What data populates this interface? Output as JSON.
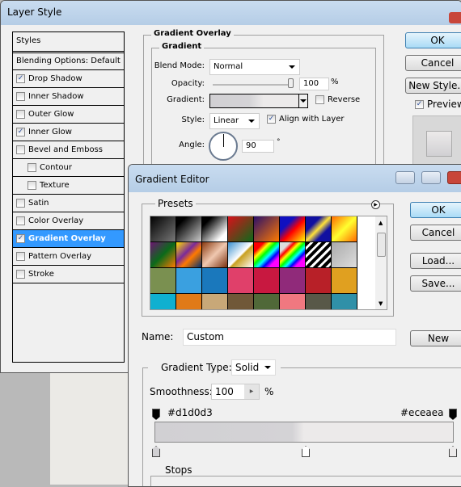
{
  "layer_style": {
    "title": "Layer Style",
    "styles_header": "Styles",
    "blending": "Blending Options: Default",
    "items": [
      {
        "label": "Drop Shadow",
        "checked": true
      },
      {
        "label": "Inner Shadow",
        "checked": false
      },
      {
        "label": "Outer Glow",
        "checked": false
      },
      {
        "label": "Inner Glow",
        "checked": true
      },
      {
        "label": "Bevel and Emboss",
        "checked": false
      },
      {
        "label": "Contour",
        "checked": false,
        "sub": true
      },
      {
        "label": "Texture",
        "checked": false,
        "sub": true
      },
      {
        "label": "Satin",
        "checked": false
      },
      {
        "label": "Color Overlay",
        "checked": false
      },
      {
        "label": "Gradient Overlay",
        "checked": true,
        "selected": true
      },
      {
        "label": "Pattern Overlay",
        "checked": false
      },
      {
        "label": "Stroke",
        "checked": false
      }
    ],
    "section_title": "Gradient Overlay",
    "group_title": "Gradient",
    "blend_mode_label": "Blend Mode:",
    "blend_mode": "Normal",
    "opacity_label": "Opacity:",
    "opacity": "100",
    "opacity_unit": "%",
    "gradient_label": "Gradient:",
    "reverse_label": "Reverse",
    "reverse": false,
    "style_label": "Style:",
    "style": "Linear",
    "align_label": "Align with Layer",
    "align": true,
    "angle_label": "Angle:",
    "angle": "90",
    "angle_unit": "°",
    "ok": "OK",
    "cancel": "Cancel",
    "new_style": "New Style...",
    "preview_label": "Preview",
    "preview": true
  },
  "gradient_editor": {
    "title": "Gradient Editor",
    "presets_label": "Presets",
    "ok": "OK",
    "cancel": "Cancel",
    "load": "Load...",
    "save": "Save...",
    "new": "New",
    "name_label": "Name:",
    "name_value": "Custom",
    "type_label": "Gradient Type:",
    "type_value": "Solid",
    "smoothness_label": "Smoothness:",
    "smoothness": "100",
    "smoothness_unit": "%",
    "left_color": "#d1d0d3",
    "right_color": "#eceaea",
    "stops_label": "Stops",
    "presets": [
      "linear-gradient(135deg,#000,#777)",
      "linear-gradient(135deg,#000 20%,#ccc)",
      "linear-gradient(135deg,#000 20%,#fff 80%)",
      "linear-gradient(135deg,#d8101a,#0b6a1a)",
      "linear-gradient(135deg,#2a0f6a,#ff7a00)",
      "linear-gradient(135deg,#1010c0 30%,#f00 55%,#ff0)",
      "linear-gradient(135deg,#1010a0 30%,#ffe23a 50%,#1010a0 70%)",
      "linear-gradient(135deg,#ff6a00,#ffff30 50%,#ff6a00)",
      "linear-gradient(135deg,#6a1570,#0b6a1a 50%,#ff7a00)",
      "linear-gradient(135deg,#ffe000,#7a2a9a 40%,#ff7a00 60%,#003070)",
      "linear-gradient(135deg,#8a3a10,#f0c8b0 50%,#7a3010)",
      "linear-gradient(135deg,#3a90d0,#fff 50%,#c8a020 55%,#fff)",
      "linear-gradient(135deg,#f00 20%,#ff0,#0f0,#0ff,#00f,#f0f 80%)",
      "linear-gradient(135deg,#ddd 20%,#f00,#ff0,#0f0,#0ff,#00f,#f0f 80%)",
      "repeating-linear-gradient(135deg,#000 0 4px,#fff 4px 7px)",
      "linear-gradient(135deg,#aaa,#ddd)",
      "#7a9050",
      "#3aa0e0",
      "#1a78bc",
      "#e0406a",
      "#c81840",
      "#902a7a",
      "#b82028",
      "#e0a020",
      "#10b0d0",
      "#e07a18",
      "#c8a878",
      "#705838",
      "#506838",
      "#f07880",
      "#585848",
      "#3090a8"
    ],
    "colors": {
      "accent": "#3399ff"
    }
  }
}
